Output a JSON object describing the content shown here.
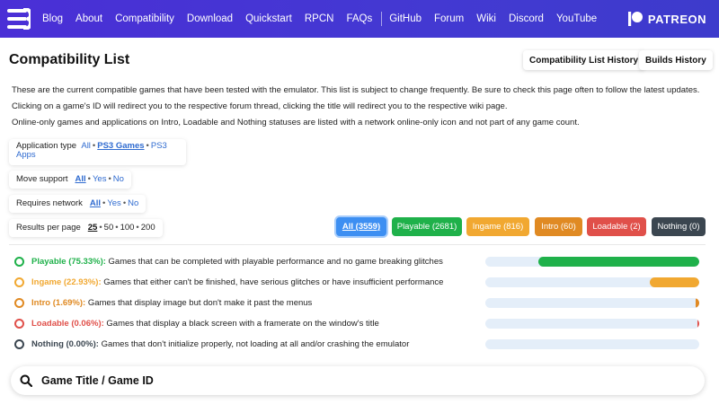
{
  "nav": {
    "links": [
      "Blog",
      "About",
      "Compatibility",
      "Download",
      "Quickstart",
      "RPCN",
      "FAQs",
      "GitHub",
      "Forum",
      "Wiki",
      "Discord",
      "YouTube"
    ],
    "patreon_label": "PATREON"
  },
  "header": {
    "title": "Compatibility List",
    "history_button": "Compatibility List History",
    "builds_button": "Builds History"
  },
  "intro": {
    "line1": "These are the current compatible games that have been tested with the emulator. This list is subject to change frequently. Be sure to check this page often to follow the latest updates.",
    "line2": "Clicking on a game's ID will redirect you to the respective forum thread, clicking the title will redirect you to the respective wiki page.",
    "line3": "Online-only games and applications on Intro, Loadable and Nothing statuses are listed with a network online-only icon and not part of any game count."
  },
  "filters": {
    "app_type": {
      "label": "Application type",
      "opt_all": "All",
      "opt_games": "PS3 Games",
      "opt_apps_1": "PS3",
      "opt_apps_2": "Apps"
    },
    "move": {
      "label": "Move support",
      "opt_all": "All",
      "opt_yes": "Yes",
      "opt_no": "No"
    },
    "network": {
      "label": "Requires network",
      "opt_all": "All",
      "opt_yes": "Yes",
      "opt_no": "No"
    },
    "per_page": {
      "label": "Results per page",
      "opt_25": "25",
      "opt_50": "50",
      "opt_100": "100",
      "opt_200": "200"
    }
  },
  "status_buttons": {
    "all": "All (3559)",
    "playable": "Playable (2681)",
    "ingame": "Ingame (816)",
    "intro": "Intro (60)",
    "loadable": "Loadable (2)",
    "nothing": "Nothing (0)"
  },
  "statuses": [
    {
      "label": "Playable (75.33%):",
      "desc": "Games that can be completed with playable performance and no game breaking glitches",
      "color": "#1fb14a",
      "percent": 75.33
    },
    {
      "label": "Ingame (22.93%):",
      "desc": "Games that either can't be finished, have serious glitches or have insufficient performance",
      "color": "#f1a831",
      "percent": 22.93
    },
    {
      "label": "Intro (1.69%):",
      "desc": "Games that display image but don't make it past the menus",
      "color": "#e08a23",
      "percent": 1.69
    },
    {
      "label": "Loadable (0.06%):",
      "desc": "Games that display a black screen with a framerate on the window's title",
      "color": "#e0504a",
      "percent": 0.06
    },
    {
      "label": "Nothing (0.00%):",
      "desc": "Games that don't initialize properly, not loading at all and/or crashing the emulator",
      "color": "#3b4650",
      "percent": 0.0
    }
  ],
  "colors": {
    "nav_bg": "#4339d2",
    "all": "#3d8ff2",
    "playable": "#1fb14a",
    "ingame": "#f1a831",
    "intro": "#e08a23",
    "loadable": "#e0504a",
    "nothing": "#3b4650"
  },
  "search": {
    "placeholder": "Game Title / Game ID"
  }
}
